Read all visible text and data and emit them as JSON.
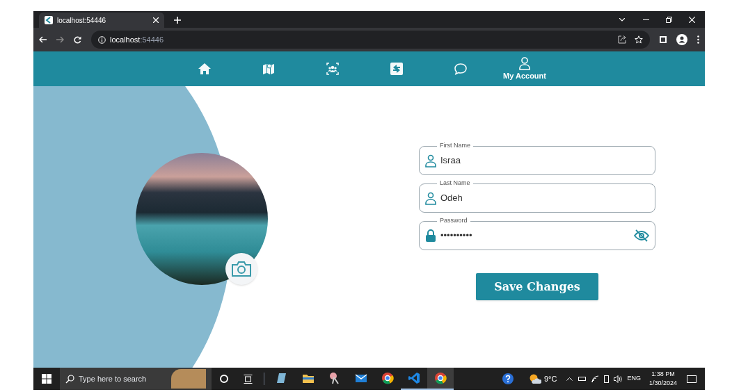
{
  "browser": {
    "tab": {
      "title": "localhost:54446"
    },
    "address": {
      "host": "localhost",
      "port": ":54446"
    }
  },
  "nav": [
    {
      "kind": "home",
      "selected": false
    },
    {
      "kind": "map",
      "selected": false
    },
    {
      "kind": "group",
      "selected": false
    },
    {
      "kind": "exchange",
      "selected": false
    },
    {
      "kind": "chat",
      "selected": false
    },
    {
      "kind": "account",
      "label": "My Account",
      "selected": true
    }
  ],
  "form": {
    "fields": [
      {
        "kind": "text",
        "label": "First Name",
        "value": "Israa"
      },
      {
        "kind": "text",
        "label": "Last Name",
        "value": "Odeh"
      },
      {
        "kind": "password",
        "label": "Password",
        "value": "••••••••••"
      }
    ],
    "button": "Save Changes"
  },
  "taskbar": {
    "search_placeholder": "Type here to search",
    "apps": [
      {
        "kind": "notes",
        "open": false,
        "selected": false
      },
      {
        "kind": "folder",
        "open": false,
        "selected": false
      },
      {
        "kind": "paint",
        "open": false,
        "selected": false
      },
      {
        "kind": "mail",
        "open": false,
        "selected": false
      },
      {
        "kind": "chrome",
        "open": false,
        "selected": false
      },
      {
        "kind": "vscode",
        "open": true,
        "selected": false
      },
      {
        "kind": "chrome",
        "open": true,
        "selected": true
      }
    ],
    "weather": "9°C",
    "language": "ENG",
    "time": "1:38 PM",
    "date": "1/30/2024"
  }
}
